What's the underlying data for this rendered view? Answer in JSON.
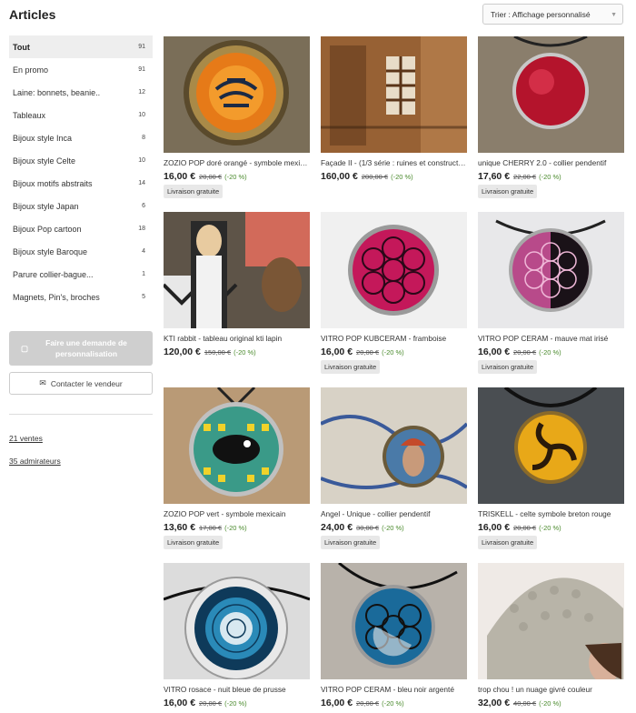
{
  "header": {
    "title": "Articles"
  },
  "sort": {
    "label": "Trier : Affichage personnalisé"
  },
  "sidebar": {
    "categories": [
      {
        "label": "Tout",
        "count": "91"
      },
      {
        "label": "En promo",
        "count": "91"
      },
      {
        "label": "Laine: bonnets, beanie..",
        "count": "12"
      },
      {
        "label": "Tableaux",
        "count": "10"
      },
      {
        "label": "Bijoux style Inca",
        "count": "8"
      },
      {
        "label": "Bijoux style Celte",
        "count": "10"
      },
      {
        "label": "Bijoux motifs abstraits",
        "count": "14"
      },
      {
        "label": "Bijoux style Japan",
        "count": "6"
      },
      {
        "label": "Bijoux Pop cartoon",
        "count": "18"
      },
      {
        "label": "Bijoux style Baroque",
        "count": "4"
      },
      {
        "label": "Parure collier-bague...",
        "count": "1"
      },
      {
        "label": "Magnets, Pin's, broches",
        "count": "5"
      }
    ],
    "custom_request": "Faire une demande de personnalisation",
    "contact": "Contacter le vendeur",
    "sales": "21 ventes",
    "admirers": "35 admirateurs"
  },
  "products": [
    {
      "title": "ZOZIO POP doré orangé - symbole mexicain",
      "price": "16,00 €",
      "old": "20,00 €",
      "disc": "(-20 %)",
      "badge": "Livraison gratuite"
    },
    {
      "title": "Façade II - (1/3 série : ruines et constructions)",
      "price": "160,00 €",
      "old": "200,00 €",
      "disc": "(-20 %)",
      "badge": ""
    },
    {
      "title": "unique CHERRY 2.0 - collier pendentif",
      "price": "17,60 €",
      "old": "22,00 €",
      "disc": "(-20 %)",
      "badge": "Livraison gratuite"
    },
    {
      "title": "KTI rabbit - tableau original kti lapin",
      "price": "120,00 €",
      "old": "150,00 €",
      "disc": "(-20 %)",
      "badge": ""
    },
    {
      "title": "VITRO POP KUBCERAM - framboise",
      "price": "16,00 €",
      "old": "20,00 €",
      "disc": "(-20 %)",
      "badge": "Livraison gratuite"
    },
    {
      "title": "VITRO POP CERAM - mauve mat irisé",
      "price": "16,00 €",
      "old": "20,00 €",
      "disc": "(-20 %)",
      "badge": "Livraison gratuite"
    },
    {
      "title": "ZOZIO POP vert - symbole mexicain",
      "price": "13,60 €",
      "old": "17,00 €",
      "disc": "(-20 %)",
      "badge": "Livraison gratuite"
    },
    {
      "title": "Angel - Unique - collier pendentif",
      "price": "24,00 €",
      "old": "30,00 €",
      "disc": "(-20 %)",
      "badge": "Livraison gratuite"
    },
    {
      "title": "TRISKELL - celte symbole breton rouge",
      "price": "16,00 €",
      "old": "20,00 €",
      "disc": "(-20 %)",
      "badge": "Livraison gratuite"
    },
    {
      "title": "VITRO rosace - nuit bleue de prusse",
      "price": "16,00 €",
      "old": "20,00 €",
      "disc": "(-20 %)",
      "badge": ""
    },
    {
      "title": "VITRO POP CERAM - bleu noir argenté",
      "price": "16,00 €",
      "old": "20,00 €",
      "disc": "(-20 %)",
      "badge": ""
    },
    {
      "title": "trop chou ! un nuage givré couleur",
      "price": "32,00 €",
      "old": "40,00 €",
      "disc": "(-20 %)",
      "badge": ""
    }
  ]
}
